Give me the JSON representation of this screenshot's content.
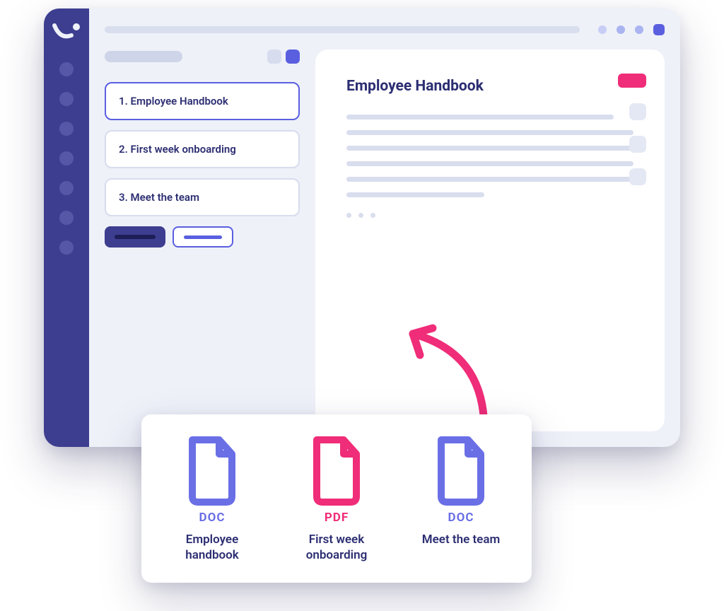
{
  "colors": {
    "indigo": "#6a6fe6",
    "navy": "#3d3e8f",
    "pink": "#ef2d78"
  },
  "sidebar": {
    "items": [
      {
        "label": "1. Employee Handbook",
        "active": true
      },
      {
        "label": "2. First week onboarding",
        "active": false
      },
      {
        "label": "3. Meet the team",
        "active": false
      }
    ]
  },
  "content": {
    "title": "Employee Handbook"
  },
  "files": [
    {
      "type": "DOC",
      "caption": "Employee handbook",
      "color": "indigo"
    },
    {
      "type": "PDF",
      "caption": "First week onboarding",
      "color": "pink"
    },
    {
      "type": "DOC",
      "caption": "Meet the team",
      "color": "indigo"
    }
  ]
}
